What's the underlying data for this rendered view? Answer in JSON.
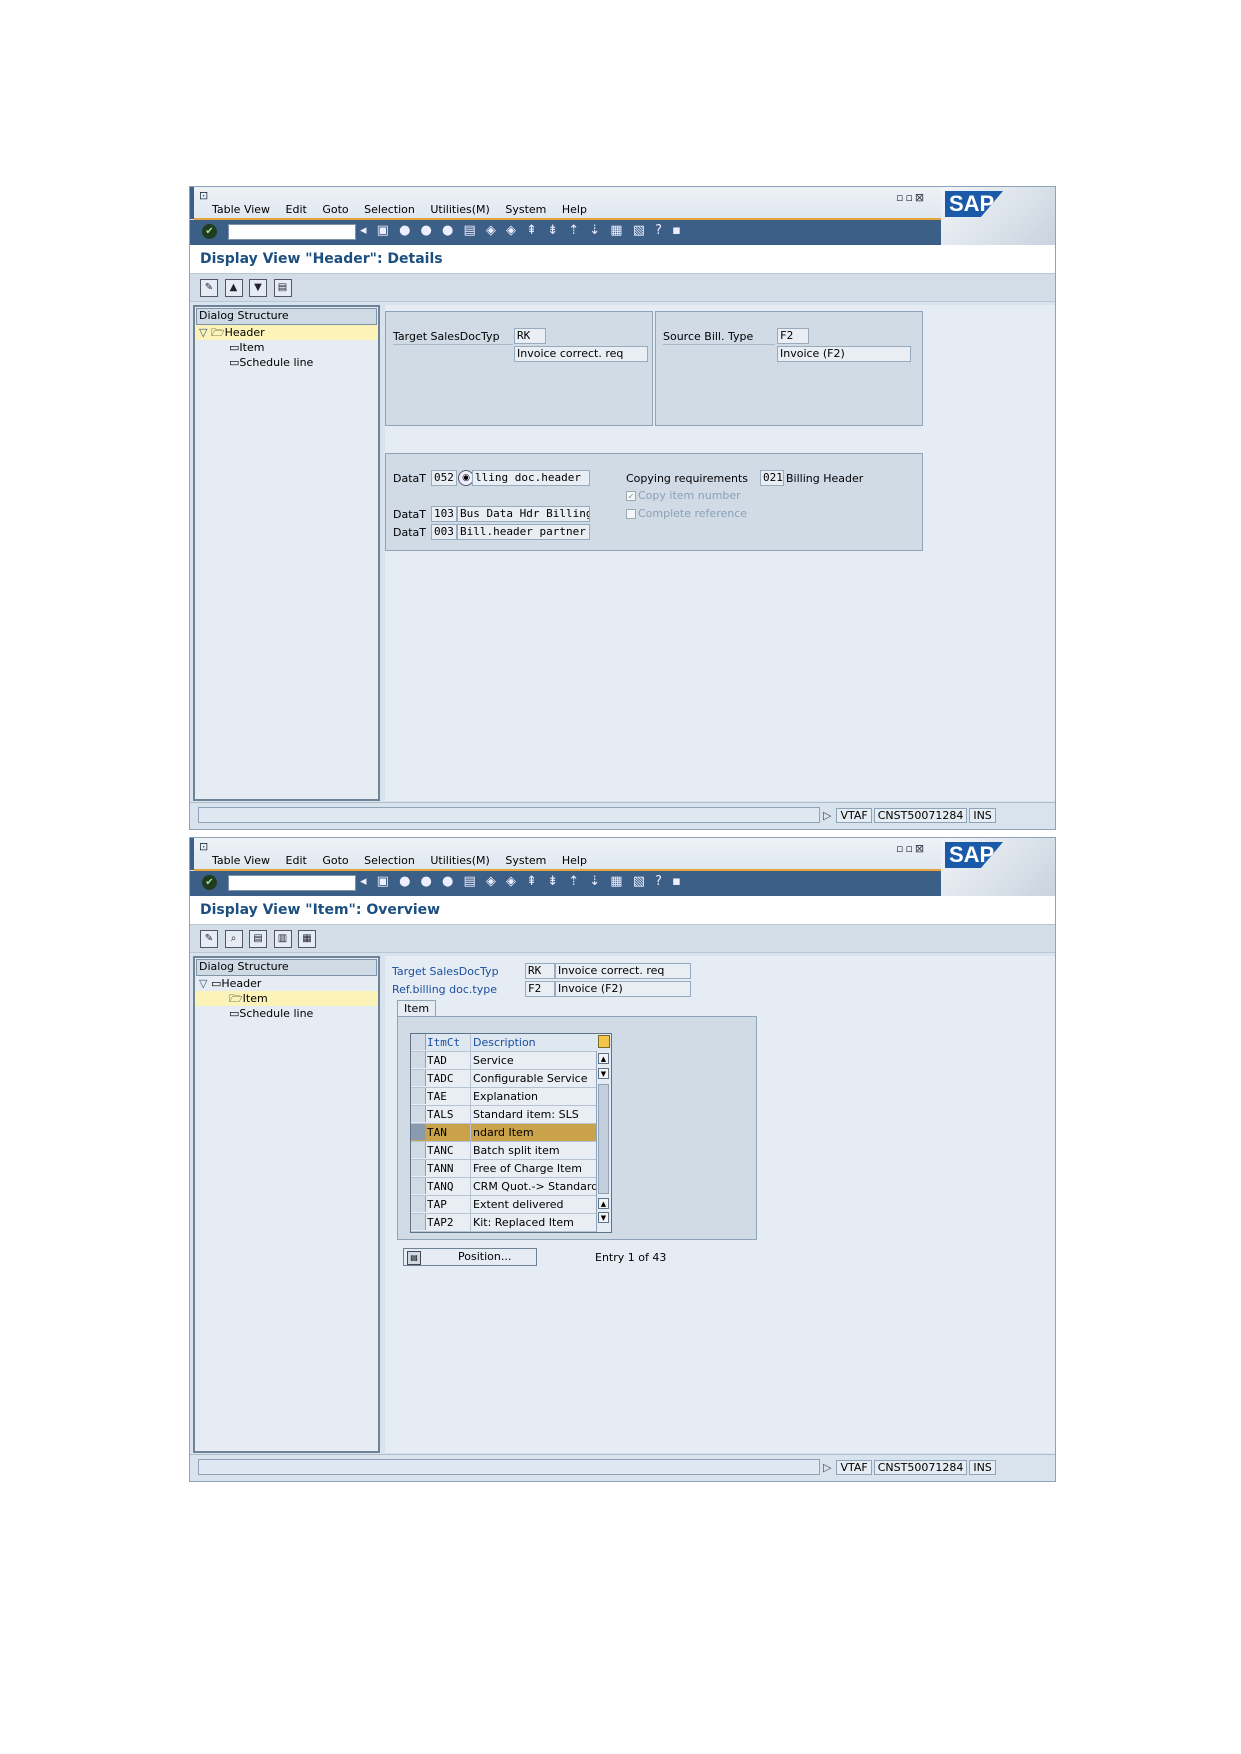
{
  "menu": [
    "Table View",
    "Edit",
    "Goto",
    "Selection",
    "Utilities(M)",
    "System",
    "Help"
  ],
  "sap_logo": "SAP",
  "window_controls": "▫▫⊠",
  "status": {
    "transaction": "VTAF",
    "server": "CNST50071284",
    "mode": "INS"
  },
  "tree": {
    "head": "Dialog Structure",
    "items": [
      "Header",
      "Item",
      "Schedule line"
    ]
  },
  "screen1": {
    "title": "Display View \"Header\": Details",
    "target_label": "Target SalesDocTyp",
    "target_value": "RK",
    "target_desc": "Invoice correct. req",
    "source_label": "Source Bill. Type",
    "source_value": "F2",
    "source_desc": "Invoice (F2)",
    "datat_label": "DataT",
    "datat1": "052",
    "datat1_desc": "lling doc.header",
    "datat2": "103",
    "datat2_desc": "Bus Data Hdr Billing",
    "datat3": "003",
    "datat3_desc": "Bill.header partner",
    "copyreq_label": "Copying requirements",
    "copyreq_value": "021",
    "copyreq_desc": "Billing Header",
    "copy_item_label": "Copy item number",
    "copy_item_checked": true,
    "complete_ref_label": "Complete reference",
    "complete_ref_checked": false
  },
  "screen2": {
    "title": "Display View \"Item\": Overview",
    "target_label": "Target SalesDocTyp",
    "target_value": "RK",
    "target_desc": "Invoice correct. req",
    "ref_label": "Ref.billing doc.type",
    "ref_value": "F2",
    "ref_desc": "Invoice (F2)",
    "tab_label": "Item",
    "columns": [
      "ItmCt",
      "Description"
    ],
    "rows": [
      {
        "cat": "TAD",
        "desc": "Service"
      },
      {
        "cat": "TADC",
        "desc": "Configurable Service"
      },
      {
        "cat": "TAE",
        "desc": "Explanation"
      },
      {
        "cat": "TALS",
        "desc": "Standard item: SLS"
      },
      {
        "cat": "TAN",
        "desc": "ndard Item"
      },
      {
        "cat": "TANC",
        "desc": "Batch split item"
      },
      {
        "cat": "TANN",
        "desc": "Free of Charge Item"
      },
      {
        "cat": "TANQ",
        "desc": "CRM Quot.-> Standard"
      },
      {
        "cat": "TAP",
        "desc": "Extent delivered"
      },
      {
        "cat": "TAP2",
        "desc": "Kit: Replaced Item"
      }
    ],
    "highlighted_row": 4,
    "position_button": "Position...",
    "entry_info": "Entry 1 of 43"
  }
}
